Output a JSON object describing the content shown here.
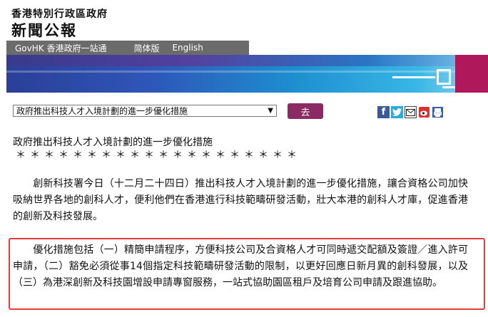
{
  "header": {
    "gov_name": "香港特別行政區政府",
    "title": "新聞公報"
  },
  "nav": {
    "govhk": "GovHK 香港政府一站通",
    "simplified": "简体版",
    "english": "English"
  },
  "toolbar": {
    "selected_article": "政府推出科技人才入境計劃的進一步優化措施",
    "go_label": "去"
  },
  "article": {
    "title": "政府推出科技人才入境計劃的進一步優化措施",
    "stars": "＊＊＊＊＊＊＊＊＊＊＊＊＊＊＊＊＊＊＊＊",
    "paragraph1": "　　創新科技署今日（十二月二十四日）推出科技人才入境計劃的進一步優化措施，讓合資格公司加快吸納世界各地的創科人才，便利他們在香港進行科技範疇研發活動，壯大本港的創科人才庫，促進香港的創新及科技發展。",
    "paragraph2": "　　優化措施包括（一）精簡申請程序，方便科技公司及合資格人才可同時遞交配額及簽證／進入許可申請，（二）豁免必須從事14個指定科技範疇研發活動的限制，以更好回應日新月異的創科發展，以及（三）為港深創新及科技園增設申請專窗服務，一站式協助園區租戶及培育公司申請及跟進協助。"
  },
  "colors": {
    "nav_bg": "#6b6b6b",
    "go_button": "#8b2a63",
    "highlight_border": "#e23c3c"
  }
}
